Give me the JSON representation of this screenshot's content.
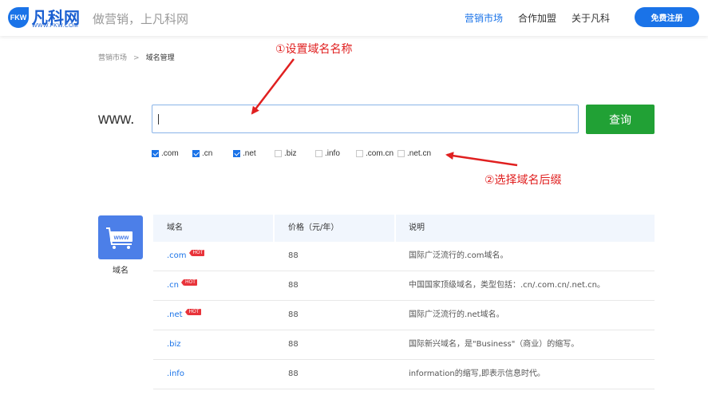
{
  "header": {
    "logo_mark": "FKW",
    "logo_name": "凡科网",
    "logo_url": "WWW.FKW.COM",
    "slogan": "做营销，上凡科网",
    "nav": [
      "营销市场",
      "合作加盟",
      "关于凡科"
    ],
    "active_nav": "营销市场",
    "register_label": "免费注册"
  },
  "breadcrumb": {
    "parent": "营销市场",
    "separator": ">",
    "current": "域名管理"
  },
  "search": {
    "prefix": "www.",
    "value": "",
    "button_label": "查询"
  },
  "suffixes": [
    {
      "label": ".com",
      "checked": true
    },
    {
      "label": ".cn",
      "checked": true
    },
    {
      "label": ".net",
      "checked": true
    },
    {
      "label": ".biz",
      "checked": false
    },
    {
      "label": ".info",
      "checked": false
    },
    {
      "label": ".com.cn",
      "checked": false
    },
    {
      "label": ".net.cn",
      "checked": false
    }
  ],
  "annotations": {
    "step1": "①设置域名名称",
    "step2": "②选择域名后缀"
  },
  "category": {
    "icon_text": "www",
    "label": "域名"
  },
  "table": {
    "headers": [
      "域名",
      "价格（元/年）",
      "说明"
    ],
    "hot_badge": "HOT",
    "rows": [
      {
        "name": ".com",
        "hot": true,
        "price": "88",
        "desc": "国际广泛流行的.com域名。"
      },
      {
        "name": ".cn",
        "hot": true,
        "price": "88",
        "desc": "中国国家顶级域名，类型包括：.cn/.com.cn/.net.cn。"
      },
      {
        "name": ".net",
        "hot": true,
        "price": "88",
        "desc": "国际广泛流行的.net域名。"
      },
      {
        "name": ".biz",
        "hot": false,
        "price": "88",
        "desc": "国际新兴域名，是\"Business\"（商业）的缩写。"
      },
      {
        "name": ".info",
        "hot": false,
        "price": "88",
        "desc": "information的缩写,即表示信息时代。"
      }
    ]
  },
  "colors": {
    "brand_blue": "#1a73e8",
    "search_green": "#21a135",
    "annotation_red": "#e02020",
    "hot_red": "#e8333a"
  }
}
